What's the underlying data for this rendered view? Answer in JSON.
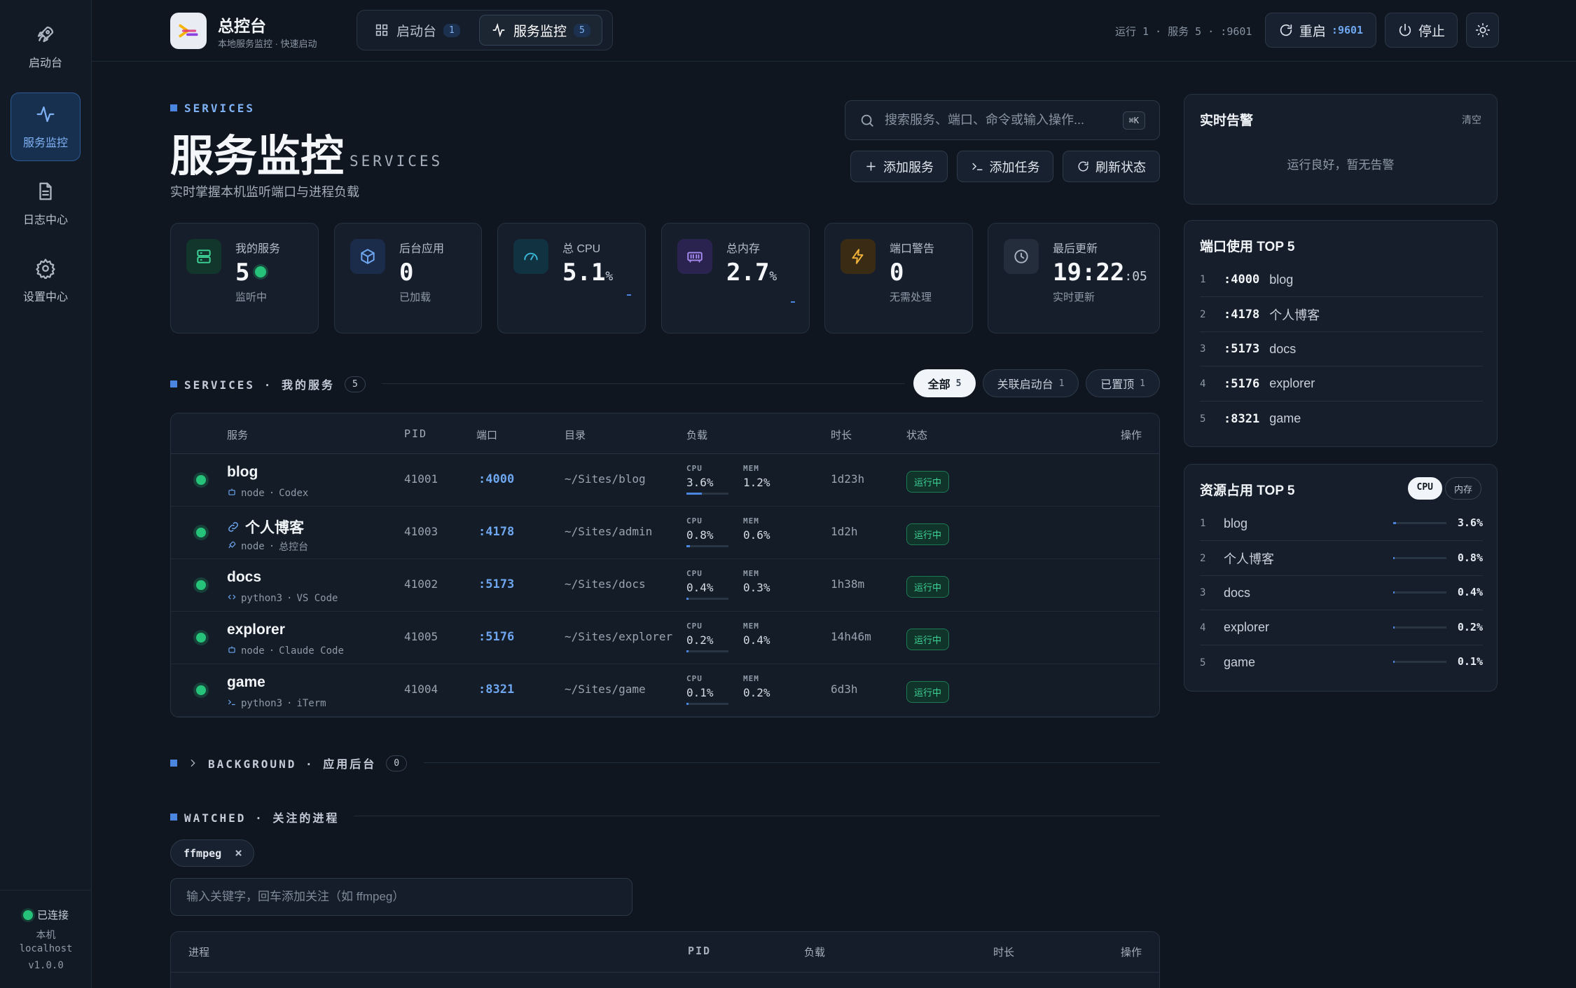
{
  "sidebar": {
    "items": [
      {
        "label": "启动台"
      },
      {
        "label": "服务监控"
      },
      {
        "label": "日志中心"
      },
      {
        "label": "设置中心"
      }
    ],
    "status": {
      "connected": "已连接",
      "host_label": "本机",
      "host": "localhost",
      "version": "v1.0.0"
    }
  },
  "header": {
    "title": "总控台",
    "subtitle": "本地服务监控 · 快速启动",
    "tabs": [
      {
        "label": "启动台",
        "count": "1"
      },
      {
        "label": "服务监控",
        "count": "5"
      }
    ],
    "run_info": "运行 1 · 服务 5 · :9601",
    "restart_label": "重启",
    "restart_port": ":9601",
    "stop_label": "停止"
  },
  "page": {
    "tag": "SERVICES",
    "title": "服务监控",
    "title_en": "SERVICES",
    "desc": "实时掌握本机监听端口与进程负载",
    "search_placeholder": "搜索服务、端口、命令或输入操作...",
    "search_kbd": "⌘K",
    "actions": [
      "添加服务",
      "添加任务",
      "刷新状态"
    ]
  },
  "stats": [
    {
      "label": "我的服务",
      "value": "5",
      "sub": "监听中"
    },
    {
      "label": "后台应用",
      "value": "0",
      "sub": "已加载"
    },
    {
      "label": "总 CPU",
      "value": "5.1",
      "unit": "%"
    },
    {
      "label": "总内存",
      "value": "2.7",
      "unit": "%"
    },
    {
      "label": "端口警告",
      "value": "0",
      "sub": "无需处理"
    },
    {
      "label": "最后更新",
      "value": "19:22",
      "seconds": ":05",
      "sub": "实时更新"
    }
  ],
  "services": {
    "heading": "SERVICES · 我的服务",
    "count": "5",
    "filters": [
      {
        "label": "全部",
        "count": "5"
      },
      {
        "label": "关联启动台",
        "count": "1"
      },
      {
        "label": "已置顶",
        "count": "1"
      }
    ],
    "columns": [
      "服务",
      "PID",
      "端口",
      "目录",
      "负载",
      "时长",
      "状态",
      "操作"
    ],
    "load_labels": {
      "cpu": "CPU",
      "mem": "MEM"
    },
    "rows": [
      {
        "name": "blog",
        "runtime": "node",
        "source": "Codex",
        "pid": "41001",
        "port": ":4000",
        "dir": "~/Sites/blog",
        "cpu": "3.6%",
        "mem": "1.2%",
        "cpu_frac": 0.036,
        "duration": "1d23h",
        "status": "运行中",
        "meta_icon": "robot-icon",
        "linked": false
      },
      {
        "name": "个人博客",
        "runtime": "node",
        "source": "总控台",
        "pid": "41003",
        "port": ":4178",
        "dir": "~/Sites/admin",
        "cpu": "0.8%",
        "mem": "0.6%",
        "cpu_frac": 0.008,
        "duration": "1d2h",
        "status": "运行中",
        "meta_icon": "rocket-icon",
        "linked": true
      },
      {
        "name": "docs",
        "runtime": "python3",
        "source": "VS Code",
        "pid": "41002",
        "port": ":5173",
        "dir": "~/Sites/docs",
        "cpu": "0.4%",
        "mem": "0.3%",
        "cpu_frac": 0.004,
        "duration": "1h38m",
        "status": "运行中",
        "meta_icon": "code-icon",
        "linked": false
      },
      {
        "name": "explorer",
        "runtime": "node",
        "source": "Claude Code",
        "pid": "41005",
        "port": ":5176",
        "dir": "~/Sites/explorer",
        "cpu": "0.2%",
        "mem": "0.4%",
        "cpu_frac": 0.002,
        "duration": "14h46m",
        "status": "运行中",
        "meta_icon": "robot-icon",
        "linked": false
      },
      {
        "name": "game",
        "runtime": "python3",
        "source": "iTerm",
        "pid": "41004",
        "port": ":8321",
        "dir": "~/Sites/game",
        "cpu": "0.1%",
        "mem": "0.2%",
        "cpu_frac": 0.001,
        "duration": "6d3h",
        "status": "运行中",
        "meta_icon": "terminal-icon",
        "linked": false
      }
    ]
  },
  "background": {
    "heading": "BACKGROUND · 应用后台",
    "count": "0"
  },
  "watched": {
    "heading": "WATCHED · 关注的进程",
    "chips": [
      "ffmpeg"
    ],
    "input_placeholder": "输入关键字，回车添加关注（如 ffmpeg）",
    "columns": [
      "进程",
      "PID",
      "负载",
      "时长",
      "操作"
    ]
  },
  "alerts": {
    "title": "实时告警",
    "clear": "清空",
    "empty": "运行良好，暂无告警"
  },
  "ports_top": {
    "title": "端口使用 TOP 5",
    "rows": [
      {
        "rank": "1",
        "port": ":4000",
        "name": "blog"
      },
      {
        "rank": "2",
        "port": ":4178",
        "name": "个人博客"
      },
      {
        "rank": "3",
        "port": ":5173",
        "name": "docs"
      },
      {
        "rank": "4",
        "port": ":5176",
        "name": "explorer"
      },
      {
        "rank": "5",
        "port": ":8321",
        "name": "game"
      }
    ]
  },
  "resource_top": {
    "title": "资源占用 TOP 5",
    "toggle": [
      "CPU",
      "内存"
    ],
    "rows": [
      {
        "rank": "1",
        "name": "blog",
        "value": "3.6%",
        "frac": 0.036
      },
      {
        "rank": "2",
        "name": "个人博客",
        "value": "0.8%",
        "frac": 0.008
      },
      {
        "rank": "3",
        "name": "docs",
        "value": "0.4%",
        "frac": 0.004
      },
      {
        "rank": "4",
        "name": "explorer",
        "value": "0.2%",
        "frac": 0.002
      },
      {
        "rank": "5",
        "name": "game",
        "value": "0.1%",
        "frac": 0.001
      }
    ]
  }
}
